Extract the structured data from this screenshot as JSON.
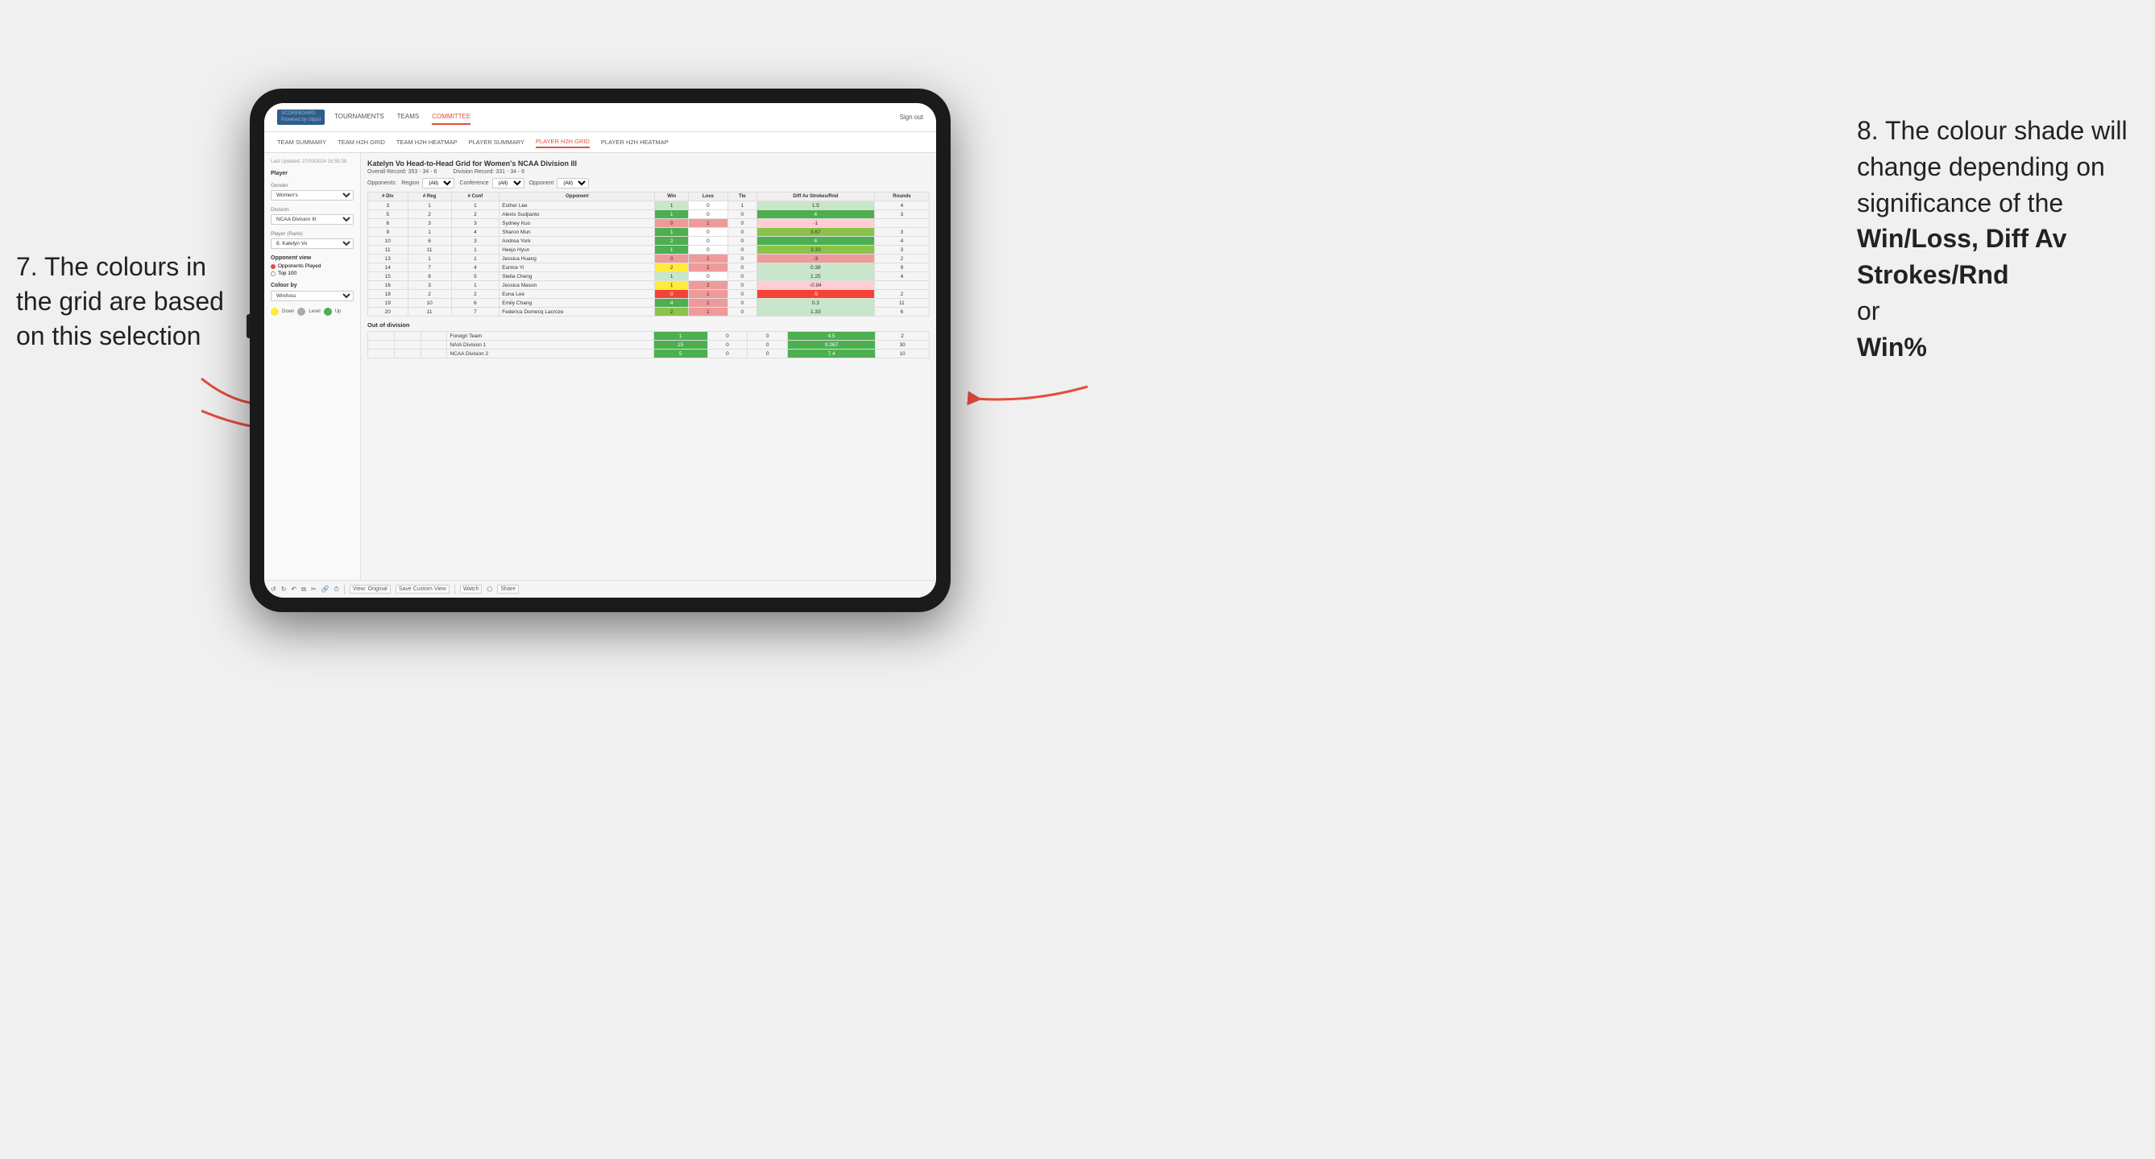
{
  "annotations": {
    "left_title": "7. The colours in the grid are based on this selection",
    "right_title": "8. The colour shade will change depending on significance of the",
    "right_bold1": "Win/Loss,",
    "right_bold2": "Diff Av Strokes/Rnd",
    "right_or": "or",
    "right_bold3": "Win%"
  },
  "nav": {
    "logo": "SCOREBOARD",
    "logo_sub": "Powered by clippd",
    "links": [
      "TOURNAMENTS",
      "TEAMS",
      "COMMITTEE"
    ],
    "sign_in": "Sign out"
  },
  "sub_nav": {
    "links": [
      "TEAM SUMMARY",
      "TEAM H2H GRID",
      "TEAM H2H HEATMAP",
      "PLAYER SUMMARY",
      "PLAYER H2H GRID",
      "PLAYER H2H HEATMAP"
    ]
  },
  "sidebar": {
    "timestamp": "Last Updated: 27/03/2024 16:55:38",
    "player_label": "Player",
    "gender_label": "Gender",
    "gender_value": "Women's",
    "division_label": "Division",
    "division_value": "NCAA Division III",
    "rank_label": "Player (Rank)",
    "rank_value": "8. Katelyn Vo",
    "opponent_view_label": "Opponent view",
    "opponent_played": "Opponents Played",
    "top100": "Top 100",
    "colour_by_label": "Colour by",
    "colour_by_value": "Win/loss",
    "legend": {
      "down_label": "Down",
      "level_label": "Level",
      "up_label": "Up"
    }
  },
  "grid": {
    "title": "Katelyn Vo Head-to-Head Grid for Women's NCAA Division III",
    "overall_record_label": "Overall Record:",
    "overall_record": "353 - 34 - 6",
    "division_record_label": "Division Record:",
    "division_record": "331 - 34 - 6",
    "filters": {
      "opponents_label": "Opponents:",
      "region_label": "Region",
      "region_value": "(All)",
      "conference_label": "Conference",
      "conference_value": "(All)",
      "opponent_label": "Opponent",
      "opponent_value": "(All)"
    },
    "table_headers": [
      "# Div",
      "# Reg",
      "# Conf",
      "Opponent",
      "Win",
      "Loss",
      "Tie",
      "Diff Av Strokes/Rnd",
      "Rounds"
    ],
    "rows": [
      {
        "div": 3,
        "reg": 1,
        "conf": 1,
        "opponent": "Esther Lee",
        "win": 1,
        "loss": 0,
        "tie": 1,
        "diff": 1.5,
        "rounds": 4,
        "win_color": "green-light",
        "diff_color": "green-light"
      },
      {
        "div": 5,
        "reg": 2,
        "conf": 2,
        "opponent": "Alexis Sudjianto",
        "win": 1,
        "loss": 0,
        "tie": 0,
        "diff": 4.0,
        "rounds": 3,
        "win_color": "green-dark",
        "diff_color": "green-dark"
      },
      {
        "div": 6,
        "reg": 3,
        "conf": 3,
        "opponent": "Sydney Kuo",
        "win": 0,
        "loss": 1,
        "tie": 0,
        "diff": -1.0,
        "rounds": "",
        "win_color": "red-mid",
        "diff_color": "red-light"
      },
      {
        "div": 9,
        "reg": 1,
        "conf": 4,
        "opponent": "Sharon Mun",
        "win": 1,
        "loss": 0,
        "tie": 0,
        "diff": 3.67,
        "rounds": 3,
        "win_color": "green-dark",
        "diff_color": "green-mid"
      },
      {
        "div": 10,
        "reg": 6,
        "conf": 3,
        "opponent": "Andrea York",
        "win": 2,
        "loss": 0,
        "tie": 0,
        "diff": 4.0,
        "rounds": 4,
        "win_color": "green-dark",
        "diff_color": "green-dark"
      },
      {
        "div": 11,
        "reg": 11,
        "conf": 1,
        "opponent": "Heejo Hyun",
        "win": 1,
        "loss": 0,
        "tie": 0,
        "diff": 3.33,
        "rounds": 3,
        "win_color": "green-dark",
        "diff_color": "green-mid"
      },
      {
        "div": 13,
        "reg": 1,
        "conf": 1,
        "opponent": "Jessica Huang",
        "win": 0,
        "loss": 1,
        "tie": 0,
        "diff": -3.0,
        "rounds": 2,
        "win_color": "red-mid",
        "diff_color": "red-mid"
      },
      {
        "div": 14,
        "reg": 7,
        "conf": 4,
        "opponent": "Eunice Yi",
        "win": 2,
        "loss": 2,
        "tie": 0,
        "diff": 0.38,
        "rounds": 9,
        "win_color": "yellow",
        "diff_color": "green-light"
      },
      {
        "div": 15,
        "reg": 8,
        "conf": 5,
        "opponent": "Stella Cheng",
        "win": 1,
        "loss": 0,
        "tie": 0,
        "diff": 1.25,
        "rounds": 4,
        "win_color": "green-light",
        "diff_color": "green-light"
      },
      {
        "div": 16,
        "reg": 3,
        "conf": 1,
        "opponent": "Jessica Mason",
        "win": 1,
        "loss": 2,
        "tie": 0,
        "diff": -0.94,
        "rounds": "",
        "win_color": "yellow",
        "diff_color": "red-light"
      },
      {
        "div": 18,
        "reg": 2,
        "conf": 2,
        "opponent": "Euna Lee",
        "win": 0,
        "loss": 1,
        "tie": 0,
        "diff": -5.0,
        "rounds": 2,
        "win_color": "red-dark",
        "diff_color": "red-dark"
      },
      {
        "div": 19,
        "reg": 10,
        "conf": 6,
        "opponent": "Emily Chang",
        "win": 4,
        "loss": 1,
        "tie": 0,
        "diff": 0.3,
        "rounds": 11,
        "win_color": "green-dark",
        "diff_color": "green-light"
      },
      {
        "div": 20,
        "reg": 11,
        "conf": 7,
        "opponent": "Federica Domecq Lacroze",
        "win": 2,
        "loss": 1,
        "tie": 0,
        "diff": 1.33,
        "rounds": 6,
        "win_color": "green-mid",
        "diff_color": "green-light"
      }
    ],
    "out_of_division_label": "Out of division",
    "out_of_division_rows": [
      {
        "opponent": "Foreign Team",
        "win": 1,
        "loss": 0,
        "tie": 0,
        "diff": 4.5,
        "rounds": 2,
        "win_color": "green-dark",
        "diff_color": "green-dark"
      },
      {
        "opponent": "NAIA Division 1",
        "win": 15,
        "loss": 0,
        "tie": 0,
        "diff": 9.267,
        "rounds": 30,
        "win_color": "green-dark",
        "diff_color": "green-dark"
      },
      {
        "opponent": "NCAA Division 2",
        "win": 5,
        "loss": 0,
        "tie": 0,
        "diff": 7.4,
        "rounds": 10,
        "win_color": "green-dark",
        "diff_color": "green-dark"
      }
    ]
  },
  "toolbar": {
    "view_original": "View: Original",
    "save_custom": "Save Custom View",
    "watch": "Watch",
    "share": "Share"
  }
}
